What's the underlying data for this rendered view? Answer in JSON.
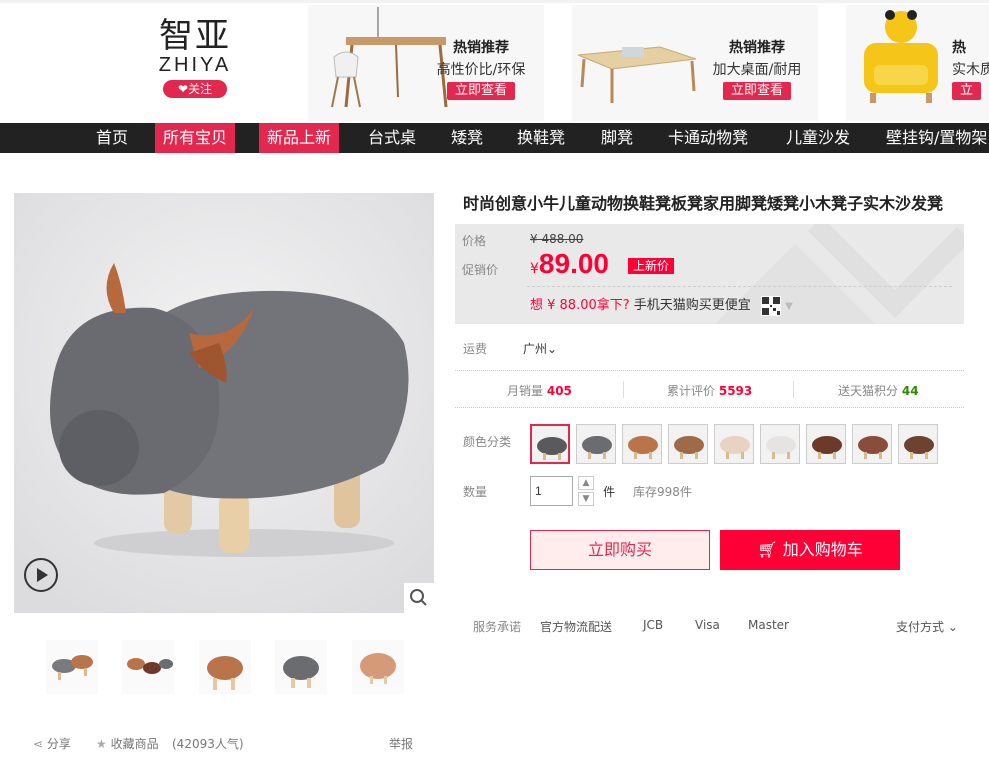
{
  "brand": {
    "name_cn": "智亚",
    "name_en": "ZHIYA",
    "follow_label": "关注",
    "accent": "#e3284f"
  },
  "promos": [
    {
      "title": "热销推荐",
      "subtitle": "高性价比/环保",
      "button": "立即查看"
    },
    {
      "title": "热销推荐",
      "subtitle": "加大桌面/耐用",
      "button": "立即查看"
    },
    {
      "title": "热",
      "subtitle": "实木质",
      "button": "立"
    }
  ],
  "nav": [
    "首页",
    "所有宝贝",
    "新品上新",
    "台式桌",
    "矮凳",
    "换鞋凳",
    "脚凳",
    "卡通动物凳",
    "儿童沙发",
    "壁挂钩/置物架"
  ],
  "product": {
    "title": "时尚创意小牛儿童动物换鞋凳板凳家用脚凳矮凳小木凳子实木沙发凳",
    "price_label": "价格",
    "original_price": "¥ 488.00",
    "promo_label": "促销价",
    "currency": "¥",
    "promo_price": "89.00",
    "promo_tag": "上新价",
    "mobile_prefix": "想 ¥ 88.00拿下?",
    "mobile_text": "手机天猫购买更便宜",
    "shipping_label": "运费",
    "shipping_value": "广州",
    "stats": [
      {
        "label": "月销量",
        "value": "405",
        "color": "#ff0036"
      },
      {
        "label": "累计评价",
        "value": "5593",
        "color": "#ff0036"
      },
      {
        "label": "送天猫积分",
        "value": "44",
        "color": "#2e8b00"
      }
    ],
    "color_label": "颜色分类",
    "swatch_colors": [
      "#5a5a5c",
      "#6b6c70",
      "#b9744a",
      "#a0694a",
      "#e8d2c0",
      "#e6e4e2",
      "#6b3a2a",
      "#8a4d3c",
      "#6d4230"
    ],
    "qty_label": "数量",
    "qty_value": "1",
    "qty_unit": "件",
    "stock": "库存998件",
    "buy_now": "立即购买",
    "add_cart": "加入购物车"
  },
  "services": {
    "label": "服务承诺",
    "items": [
      "官方物流配送",
      "JCB",
      "Visa",
      "Master"
    ],
    "payment": "支付方式"
  },
  "footer": {
    "share": "分享",
    "collect": "收藏商品",
    "popularity": "(42093人气)",
    "report": "举报"
  }
}
